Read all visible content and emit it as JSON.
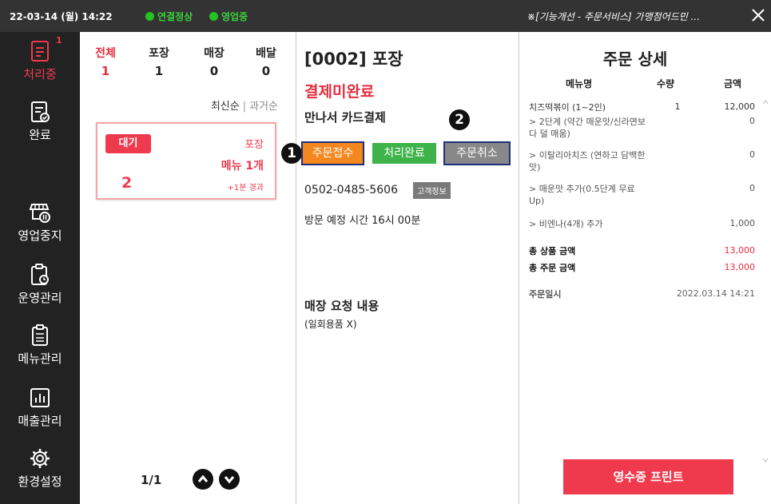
{
  "topbar": {
    "datetime": "22-03-14 (월) 14:22",
    "connection_status": "연결정상",
    "business_status": "영업중",
    "notice": "※[기능개선 - 주문서비스] 가맹점어드민 ...",
    "status_color": "#22c322"
  },
  "nav": {
    "items": [
      {
        "label": "처리중",
        "icon": "order-list-icon",
        "badge": "1",
        "active": true
      },
      {
        "label": "완료",
        "icon": "completed-check-icon"
      },
      {
        "label": "영업중지",
        "icon": "store-pause-icon"
      },
      {
        "label": "운영관리",
        "icon": "clipboard-clock-icon"
      },
      {
        "label": "메뉴관리",
        "icon": "menu-clipboard-icon"
      },
      {
        "label": "매출관리",
        "icon": "bar-chart-icon"
      },
      {
        "label": "환경설정",
        "icon": "gear-icon"
      }
    ],
    "accent": "#ef3a4e"
  },
  "order_list": {
    "tabs": [
      {
        "label": "전체",
        "count": "1"
      },
      {
        "label": "포장",
        "count": "1"
      },
      {
        "label": "매장",
        "count": "0"
      },
      {
        "label": "배달",
        "count": "0"
      }
    ],
    "sort_newest": "최신순",
    "sort_oldest": "과거순",
    "card": {
      "status": "대기",
      "number": "2",
      "type": "포장",
      "menu_count": "메뉴 1개",
      "elapsed": "+1분 경과"
    },
    "pager": "1/1"
  },
  "order_info": {
    "title": "[0002] 포장",
    "payment_status": "결제미완료",
    "payment_method": "만나서 카드결제",
    "buttons": {
      "accept": "주문접수",
      "complete": "처리완료",
      "cancel": "주문취소"
    },
    "markers": [
      "1",
      "2"
    ],
    "phone": "0502-0485-5606",
    "customer_info": "고객정보",
    "visit_time": "방문 예정 시간 16시 00분",
    "request_title": "매장 요청 내용",
    "request_value": "(일회용품 X)"
  },
  "order_detail": {
    "title": "주문 상세",
    "headers": {
      "menu": "메뉴명",
      "qty": "수량",
      "amount": "금액"
    },
    "items": [
      {
        "name": "치즈떡볶이 (1~2인)",
        "qty": "1",
        "amount": "12,000"
      },
      {
        "name": "> 2단계 (약간 매운맛/신라면보다 덜 매움)",
        "qty": "",
        "amount": "0"
      },
      {
        "name": "> 이탈리아치즈 (연하고 담백한맛)",
        "qty": "",
        "amount": "0"
      },
      {
        "name": "> 매운맛 추가(0.5단계 무료Up)",
        "qty": "",
        "amount": "0"
      },
      {
        "name": "> 비엔나(4개) 추가",
        "qty": "",
        "amount": "1,000"
      }
    ],
    "total_product_label": "총 상품 금액",
    "total_product_value": "13,000",
    "total_order_label": "총 주문 금액",
    "total_order_value": "13,000",
    "order_time_label": "주문일시",
    "order_time_value": "2022.03.14 14:21",
    "print_button": "영수증 프린트"
  }
}
